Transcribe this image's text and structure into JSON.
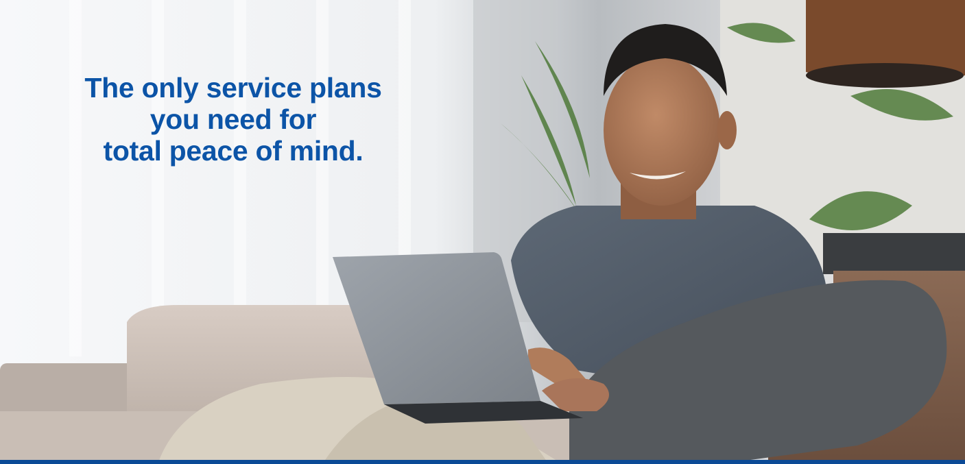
{
  "hero": {
    "headline_lines": [
      "The only service plans",
      "you need for",
      "total peace of mind."
    ]
  },
  "colors": {
    "headline": "#0c54a7",
    "bar": "#0b4a96"
  }
}
